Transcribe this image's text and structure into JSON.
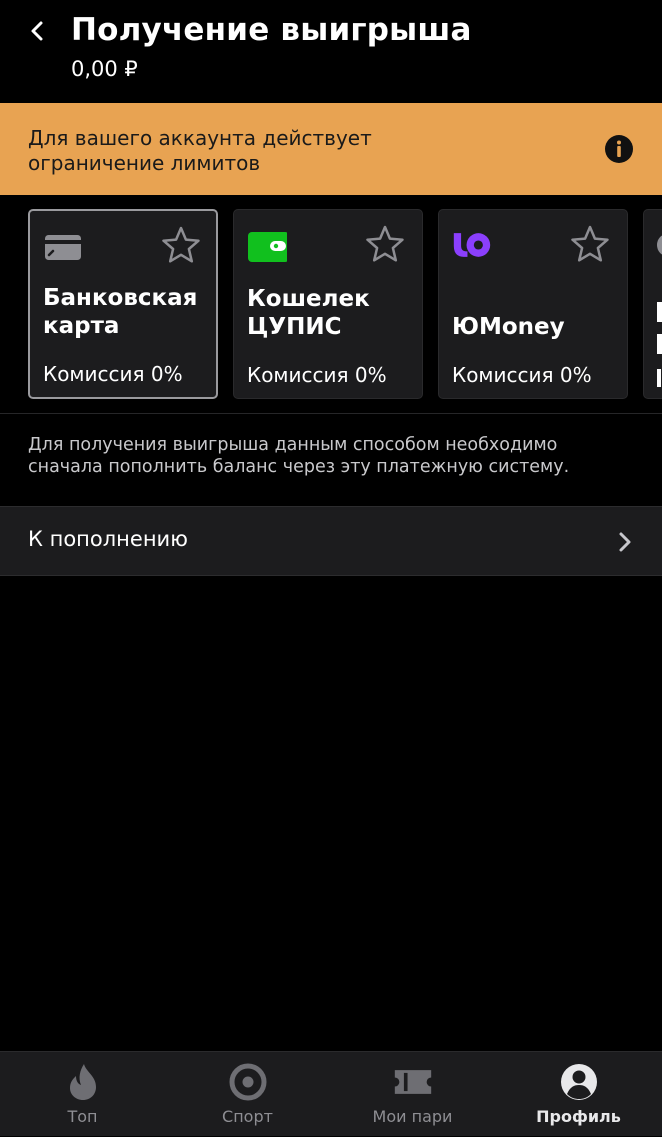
{
  "header": {
    "title": "Получение выигрыша",
    "balance": "0,00 ₽"
  },
  "banner": {
    "text": "Для вашего аккаунта действует\nограничение лимитов",
    "background": "#E8A352",
    "icon": "info-icon"
  },
  "payment_methods": [
    {
      "name": "Банковская\nкарта",
      "fee": "Комиссия 0%",
      "icon": "bank-card-icon",
      "selected": true,
      "favorite": false
    },
    {
      "name": "Кошелек\nЦУПИС",
      "fee": "Комиссия 0%",
      "icon": "wallet-icon",
      "icon_color": "#11C01E",
      "selected": false,
      "favorite": false
    },
    {
      "name": "ЮMoney",
      "fee": "Комиссия 0%",
      "icon": "yoomoney-icon",
      "icon_color": "#8B3FFD",
      "selected": false,
      "favorite": false
    }
  ],
  "note": "Для получения выигрыша данным способом необходимо\nсначала пополнить баланс через эту платежную систему.",
  "topup": {
    "label": "К пополнению"
  },
  "tabbar": {
    "tabs": [
      {
        "label": "Топ",
        "icon": "flame-icon",
        "active": false
      },
      {
        "label": "Спорт",
        "icon": "target-icon",
        "active": false
      },
      {
        "label": "Мои пари",
        "icon": "ticket-icon",
        "active": false
      },
      {
        "label": "Профиль",
        "icon": "profile-icon",
        "active": true
      }
    ]
  }
}
